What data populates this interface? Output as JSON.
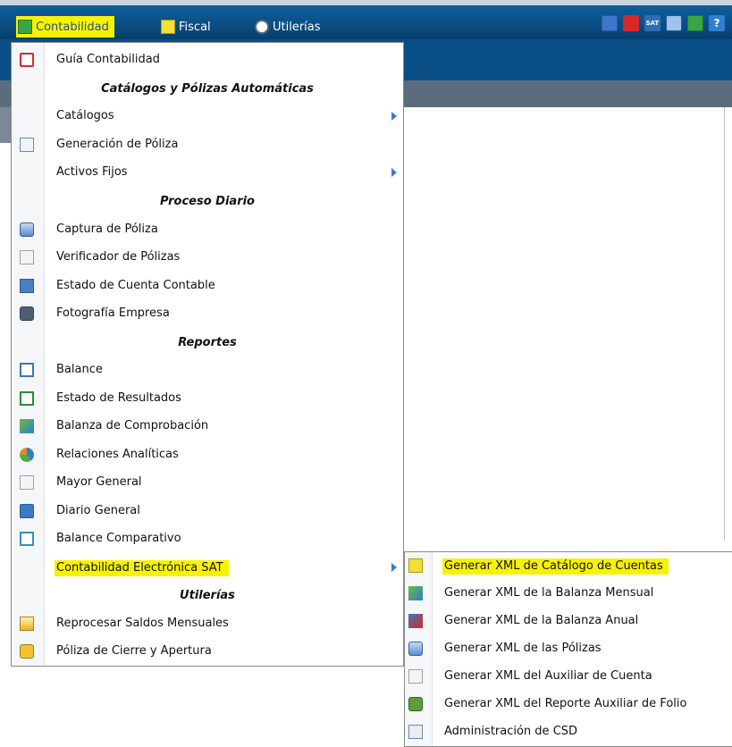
{
  "topbar": {
    "items": [
      {
        "label": "Contabilidad",
        "icon": "ledger-icon",
        "active": true
      },
      {
        "label": "Fiscal",
        "icon": "folder-icon",
        "active": false
      },
      {
        "label": "Utilerías",
        "icon": "tools-icon",
        "active": false
      }
    ],
    "right_icons": [
      "screen-icon",
      "tree-icon",
      "sat-icon",
      "calculator-icon",
      "exit-icon",
      "help-icon"
    ],
    "sat_text": "SAT",
    "help_text": "?"
  },
  "menu": {
    "items": [
      {
        "type": "item",
        "label": "Guía Contabilidad",
        "icon": "pdf-icon"
      },
      {
        "type": "header",
        "label": "Catálogos y Pólizas Automáticas"
      },
      {
        "type": "item",
        "label": "Catálogos",
        "icon": "",
        "submenu": true
      },
      {
        "type": "item",
        "label": "Generación de Póliza",
        "icon": "document-gear-icon"
      },
      {
        "type": "item",
        "label": "Activos Fijos",
        "icon": "",
        "submenu": true
      },
      {
        "type": "header",
        "label": "Proceso Diario"
      },
      {
        "type": "item",
        "label": "Captura de Póliza",
        "icon": "disk-icon"
      },
      {
        "type": "item",
        "label": "Verificador de Pólizas",
        "icon": "checklist-icon"
      },
      {
        "type": "item",
        "label": "Estado de Cuenta Contable",
        "icon": "edit-icon"
      },
      {
        "type": "item",
        "label": "Fotografía Empresa",
        "icon": "camera-icon"
      },
      {
        "type": "header",
        "label": "Reportes"
      },
      {
        "type": "item",
        "label": "Balance",
        "icon": "balance-icon"
      },
      {
        "type": "item",
        "label": "Estado de Resultados",
        "icon": "report-icon"
      },
      {
        "type": "item",
        "label": "Balanza de Comprobación",
        "icon": "chart-icon"
      },
      {
        "type": "item",
        "label": "Relaciones Analíticas",
        "icon": "pie-chart-icon"
      },
      {
        "type": "item",
        "label": "Mayor General",
        "icon": "page-icon"
      },
      {
        "type": "item",
        "label": "Diario General",
        "icon": "book-icon"
      },
      {
        "type": "item",
        "label": "Balance Comparativo",
        "icon": "compare-icon"
      },
      {
        "type": "item",
        "label": "Contabilidad Electrónica SAT",
        "icon": "",
        "submenu": true,
        "highlighted": true
      },
      {
        "type": "header",
        "label": "Utilerías"
      },
      {
        "type": "item",
        "label": "Reprocesar Saldos Mensuales",
        "icon": "warning-icon"
      },
      {
        "type": "item",
        "label": "Póliza de Cierre y Apertura",
        "icon": "lock-icon"
      }
    ]
  },
  "submenu": {
    "items": [
      {
        "label": "Generar XML de Catálogo de Cuentas",
        "icon": "notebook-icon",
        "highlighted": true
      },
      {
        "label": "Generar XML de la Balanza Mensual",
        "icon": "chart-icon"
      },
      {
        "label": "Generar XML de la Balanza Anual",
        "icon": "chart-red-icon"
      },
      {
        "label": "Generar XML de las Pólizas",
        "icon": "disk-icon"
      },
      {
        "label": "Generar XML del Auxiliar de Cuenta",
        "icon": "page-icon"
      },
      {
        "label": "Generar XML del Reporte Auxiliar de Folio",
        "icon": "gear-report-icon"
      },
      {
        "label": "Administración de CSD",
        "icon": "screen-key-icon"
      }
    ]
  }
}
